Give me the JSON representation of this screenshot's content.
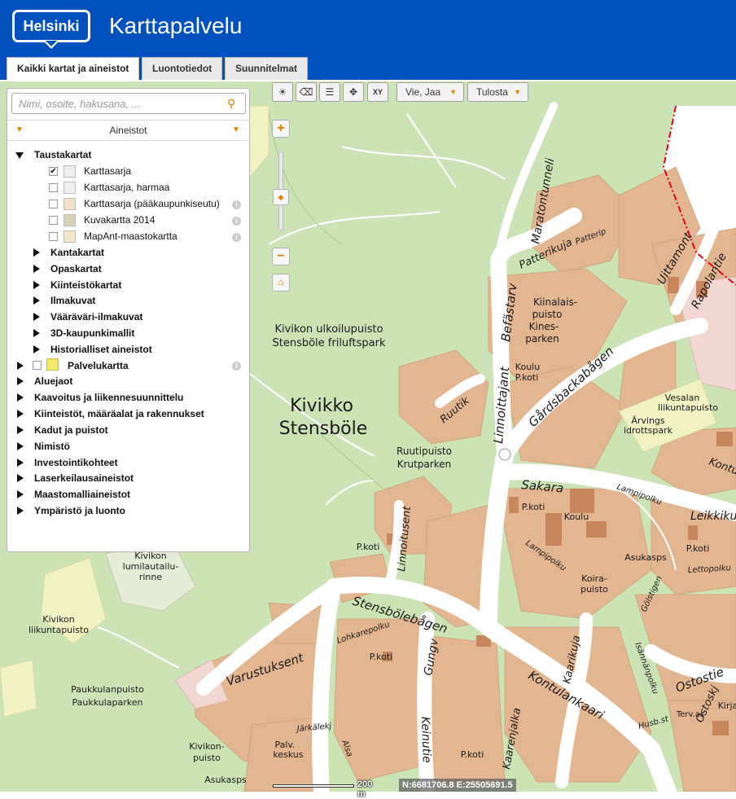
{
  "header": {
    "logo_text": "Helsinki",
    "app_title": "Karttapalvelu",
    "brand_color": "#0050bd"
  },
  "tabs": [
    {
      "label": "Kaikki kartat ja aineistot",
      "active": true
    },
    {
      "label": "Luontotiedot",
      "active": false
    },
    {
      "label": "Suunnitelmat",
      "active": false
    }
  ],
  "toolbar": {
    "icons": [
      "sun-icon",
      "eraser-icon",
      "legend-icon",
      "move-icon",
      "xy-icon"
    ],
    "xy_label": "XY",
    "share_label": "Vie, Jaa",
    "print_label": "Tulosta"
  },
  "panel": {
    "search_placeholder": "Nimi, osoite, hakusana, ...",
    "section_title": "Aineistot",
    "groups": {
      "taustakartat": {
        "label": "Taustakartat",
        "layers": [
          {
            "label": "Karttasarja",
            "checked": true,
            "has_info": false
          },
          {
            "label": "Karttasarja, harmaa",
            "checked": false,
            "has_info": false
          },
          {
            "label": "Karttasarja (pääkaupunkiseutu)",
            "checked": false,
            "has_info": true
          },
          {
            "label": "Kuvakartta 2014",
            "checked": false,
            "has_info": true
          },
          {
            "label": "MapAnt-maastokartta",
            "checked": false,
            "has_info": true
          }
        ]
      },
      "subgroups": [
        "Kantakartat",
        "Opaskartat",
        "Kiinteistökartat",
        "Ilmakuvat",
        "Vääräväri-ilmakuvat",
        "3D-kaupunkimallit",
        "Historialliset aineistot"
      ],
      "palvelukartta": "Palvelukartta",
      "top_groups": [
        "Aluejaot",
        "Kaavoitus ja liikennesuunnittelu",
        "Kiinteistöt, määräalat ja rakennukset",
        "Kadut ja puistot",
        "Nimistö",
        "Investointikohteet",
        "Laserkeilausaineistot",
        "Maastomalliaineistot",
        "Ympäristö ja luonto"
      ]
    }
  },
  "map": {
    "labels": {
      "district_fi": "Kivikko",
      "district_sv": "Stensböle",
      "park_fi": "Kivikon ulkoilupuisto",
      "park_sv": "Stensböle friluftspark",
      "ruutipuisto_fi": "Ruutipuisto",
      "ruutipuisto_sv": "Krutparken",
      "kinalaispuisto": "Kiinalais-",
      "kinalaispuisto2": "puisto",
      "kines": "Kines-",
      "kines2": "parken",
      "lumi1": "Kivikon",
      "lumi2": "lumilautailu-",
      "lumi3": "rinne",
      "liikunta1": "Kivikon",
      "liikunta2": "liikuntapuisto",
      "paukkula1": "Paukkulanpuisto",
      "paukkula2": "Paukkulaparken",
      "kivikonpuisto1": "Kivikon-",
      "kivikonpuisto2": "puisto",
      "vesala1": "Vesalan",
      "vesala2": "liikuntapuisto",
      "arvings1": "Ärvings",
      "arvings2": "idrottspark",
      "koirapuisto1": "Koira-",
      "koirapuisto2": "puisto",
      "koulu": "Koulu",
      "pkoti": "P.koti",
      "asukasps": "Asukasps",
      "palv1": "Palv.",
      "palv2": "keskus",
      "terv": "Terv.as",
      "kirja": "Kirja"
    },
    "streets": {
      "maratontunneli": "Maratontunneli",
      "linnoittajant": "Linnoittajant",
      "befastarv": "Befästarv",
      "gardsbacka": "Gårdsbackabågen",
      "sakara": "Sakara",
      "stensbole": "Stensbölebågen",
      "linnoitusent": "Linnoitusent",
      "varustuksent": "Varustuksent",
      "gungv": "Gungv",
      "keinutie": "Keinutie",
      "kontulankaari": "Kontulankaari",
      "kaarikuja": "Kaarikuja",
      "kaarenjalka": "Kaarenjalka",
      "ruutik": "Ruutik",
      "patterikuja": "Patterikuja",
      "patterip": "Patterip",
      "lampipolku": "Lampipolku",
      "lampipolku2": "Lampipolku",
      "leikkikuja": "Leikkiku",
      "lettopolku": "Lettopolku",
      "golstigen": "Gölstigen",
      "isannanpolku": "Isännänpolku",
      "ostostie": "Ostostie",
      "ostosk": "Ostoskj",
      "uittamont": "Uittamont",
      "rapolantie": "Rapolantie",
      "lohkare": "Lohkarepolku",
      "jarkalekj": "Järkälekj",
      "alsa": "Alsa",
      "kontu": "Kontu",
      "husb": "Husb.st"
    },
    "colors": {
      "green": "#c9e2b2",
      "residential": "#e3b692",
      "road": "#ffffff",
      "sport": "#f0f2c4",
      "boundary": "#e0001a"
    }
  },
  "scale": {
    "label": "200 m"
  },
  "coords": {
    "text": "N:6681706.8 E:25505691.5"
  }
}
